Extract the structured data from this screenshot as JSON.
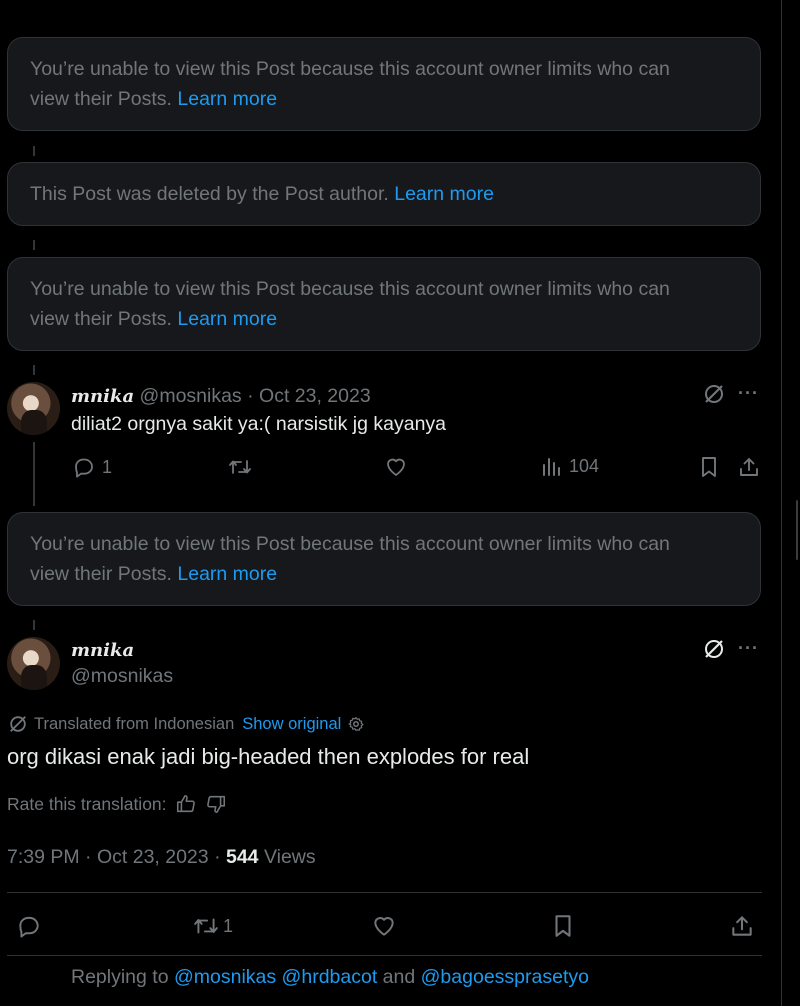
{
  "notices": [
    {
      "line1": "You’re unable to view this Post because this account owner limits who can",
      "line2": "view their Posts.",
      "link": "Learn more"
    },
    {
      "text": "This Post was deleted by the Post author.",
      "link": "Learn more"
    },
    {
      "line1": "You’re unable to view this Post because this account owner limits who can",
      "line2": "view their Posts.",
      "link": "Learn more"
    },
    {
      "line1": "You’re unable to view this Post because this account owner limits who can",
      "line2": "view their Posts.",
      "link": "Learn more"
    }
  ],
  "reply": {
    "display_name": "mnika",
    "handle": "@mosnikas",
    "separator": "·",
    "date": "Oct 23, 2023",
    "text": "diliat2 orgnya sakit ya:( narsistik jg kayanya",
    "reply_count": "1",
    "views": "104",
    "more": "···"
  },
  "main": {
    "display_name": "mnika",
    "handle": "@mosnikas",
    "more": "···",
    "translated_label": "Translated from Indonesian",
    "show_original": "Show original",
    "text": "org dikasi enak jadi big-headed then explodes for real",
    "rate_label": "Rate this translation:",
    "time": "7:39 PM",
    "sep": "·",
    "date": "Oct 23, 2023",
    "sep2": "·",
    "views_count": "544",
    "views_label": "Views",
    "retweet_count": "1"
  },
  "replying": {
    "prefix": "Replying to",
    "handles": "@mosnikas @hrdbacot",
    "and": "and",
    "last": "@bagoessprasetyo"
  }
}
